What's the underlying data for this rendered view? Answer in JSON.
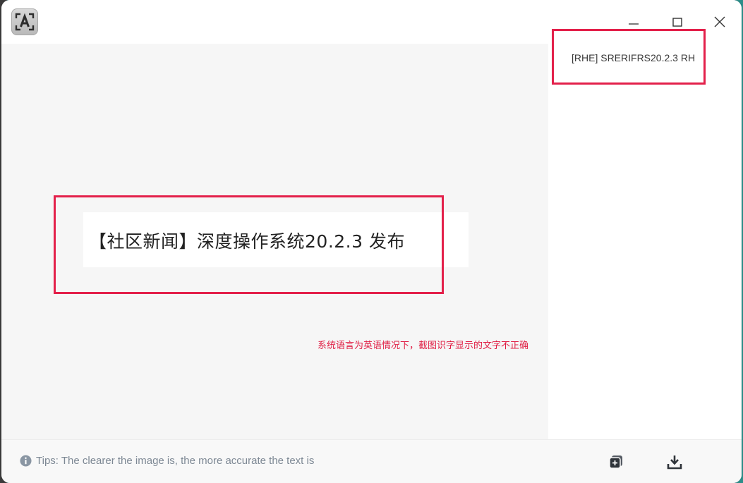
{
  "window": {
    "app_icon": "ocr-text-recognition-icon",
    "controls": {
      "minimize_icon": "minimize-icon",
      "maximize_icon": "maximize-icon",
      "close_icon": "close-icon"
    }
  },
  "result_panel": {
    "recognized_text": "[RHE] SRERIFRS20.2.3 RH"
  },
  "preview": {
    "captured_text": "【社区新闻】深度操作系统20.2.3 发布"
  },
  "annotation": {
    "note": "系统语言为英语情况下，截图识字显示的文字不正确"
  },
  "bottom_bar": {
    "tips": "Tips: The clearer the image is, the more accurate the text is",
    "tips_icon": "info-icon",
    "copy_icon": "copy-icon",
    "save_icon": "download-icon"
  },
  "colors": {
    "highlight_red": "#e3204a",
    "annotation_red": "#e01d43",
    "tips_gray": "#7d8894"
  }
}
